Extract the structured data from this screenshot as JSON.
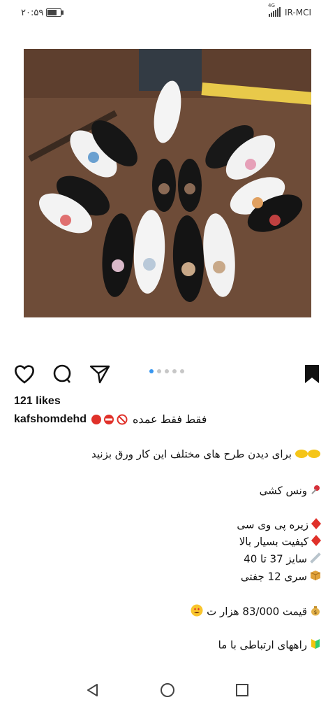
{
  "status_bar": {
    "time": "۲۰:۵۹",
    "battery_level": 0.7,
    "network": "4G",
    "carrier": "IR-MCI"
  },
  "post": {
    "image_alt_icon": "shoe-photo",
    "carousel": {
      "count": 5,
      "active_index": 0
    },
    "likes_text": "121 likes",
    "username": "kafshomdehd",
    "caption_tail": "فقط فقط عمده",
    "lines": {
      "browse": "برای دیدن طرح های مختلف این کار ورق بزنید",
      "model": "ونس کشی",
      "sole": "زیره پی وی سی",
      "quality": "کیفیت بسیار بالا",
      "size": "سایز 37 تا 40",
      "series": "سری 12 جفتی",
      "price": "قیمت 83/000 هزار ت",
      "contact": "راههای ارتباطی با ما"
    }
  },
  "colors": {
    "active_dot": "#3897f0",
    "red_badge": "#e0312a",
    "text": "#111111"
  }
}
